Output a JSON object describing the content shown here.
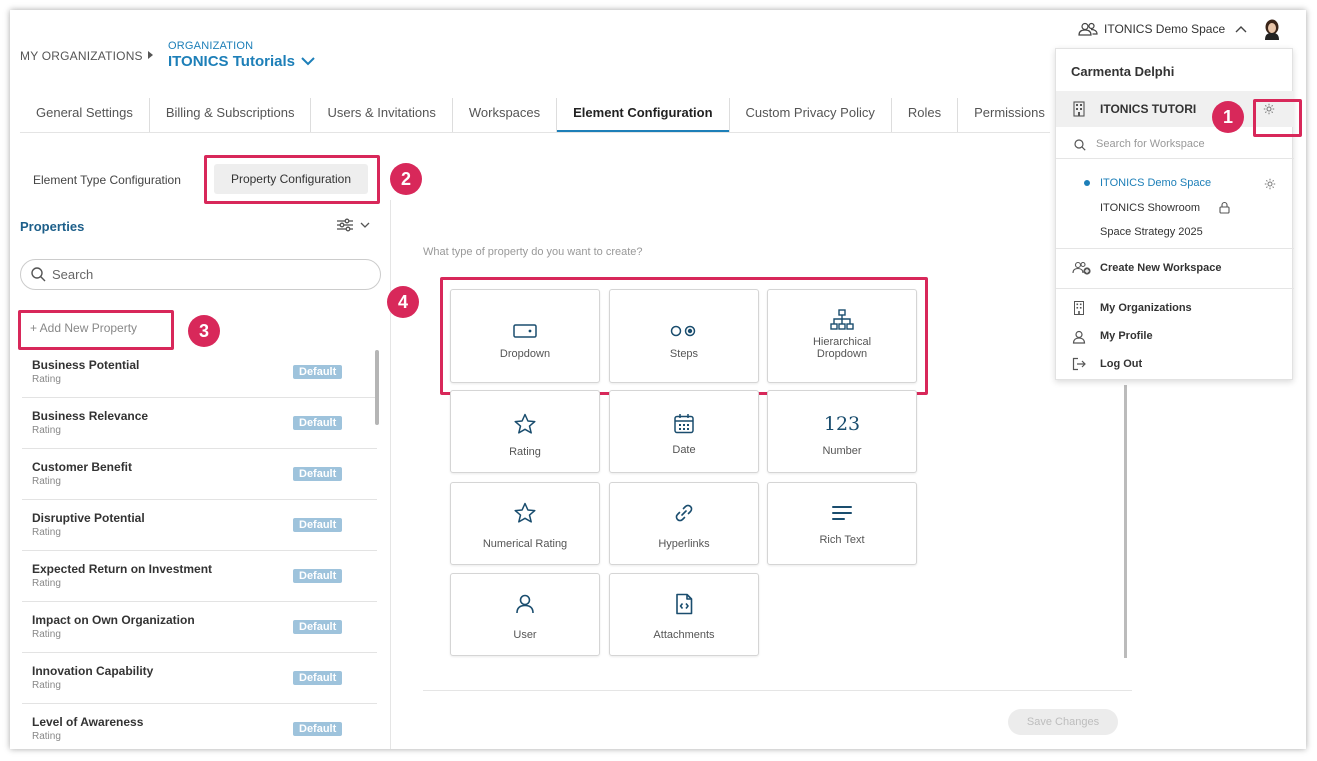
{
  "breadcrumb": {
    "root": "MY ORGANIZATIONS",
    "label": "ORGANIZATION",
    "org": "ITONICS Tutorials"
  },
  "tabs": [
    {
      "label": "General Settings"
    },
    {
      "label": "Billing & Subscriptions"
    },
    {
      "label": "Users & Invitations"
    },
    {
      "label": "Workspaces"
    },
    {
      "label": "Element Configuration",
      "active": true
    },
    {
      "label": "Custom Privacy Policy"
    },
    {
      "label": "Roles"
    },
    {
      "label": "Permissions"
    }
  ],
  "subtabs": {
    "element_type": "Element Type Configuration",
    "property": "Property Configuration"
  },
  "annotations": {
    "one": "1",
    "two": "2",
    "three": "3",
    "four": "4"
  },
  "properties": {
    "title": "Properties",
    "search_placeholder": "Search",
    "add_new": "+ Add New Property",
    "items": [
      {
        "name": "Business Potential",
        "type": "Rating",
        "badge": "Default"
      },
      {
        "name": "Business Relevance",
        "type": "Rating",
        "badge": "Default"
      },
      {
        "name": "Customer Benefit",
        "type": "Rating",
        "badge": "Default"
      },
      {
        "name": "Disruptive Potential",
        "type": "Rating",
        "badge": "Default"
      },
      {
        "name": "Expected Return on Investment",
        "type": "Rating",
        "badge": "Default"
      },
      {
        "name": "Impact on Own Organization",
        "type": "Rating",
        "badge": "Default"
      },
      {
        "name": "Innovation Capability",
        "type": "Rating",
        "badge": "Default"
      },
      {
        "name": "Level of Awareness",
        "type": "Rating",
        "badge": "Default"
      }
    ]
  },
  "main": {
    "question": "What type of property do you want to create?",
    "types": {
      "dropdown": "Dropdown",
      "steps": "Steps",
      "hier1": "Hierarchical",
      "hier2": "Dropdown",
      "rating": "Rating",
      "date": "Date",
      "number": "Number",
      "number_glyph": "123",
      "numrating": "Numerical Rating",
      "hyperlinks": "Hyperlinks",
      "richtext": "Rich Text",
      "user": "User",
      "attachments": "Attachments"
    },
    "save": "Save Changes"
  },
  "header_right": {
    "workspace": "ITONICS Demo Space"
  },
  "dropdown": {
    "user_name": "Carmenta Delphi",
    "org_name": "ITONICS TUTORI",
    "search_placeholder": "Search for Workspace",
    "workspaces": [
      {
        "name": "ITONICS Demo Space",
        "active": true
      },
      {
        "name": "ITONICS Showroom",
        "locked": true
      },
      {
        "name": "Space Strategy 2025"
      }
    ],
    "create": "Create New Workspace",
    "my_orgs": "My Organizations",
    "my_profile": "My Profile",
    "logout": "Log Out"
  },
  "colors": {
    "accent": "#1d7fb8",
    "annotation": "#d8285a",
    "badge": "#9ec3dc"
  }
}
